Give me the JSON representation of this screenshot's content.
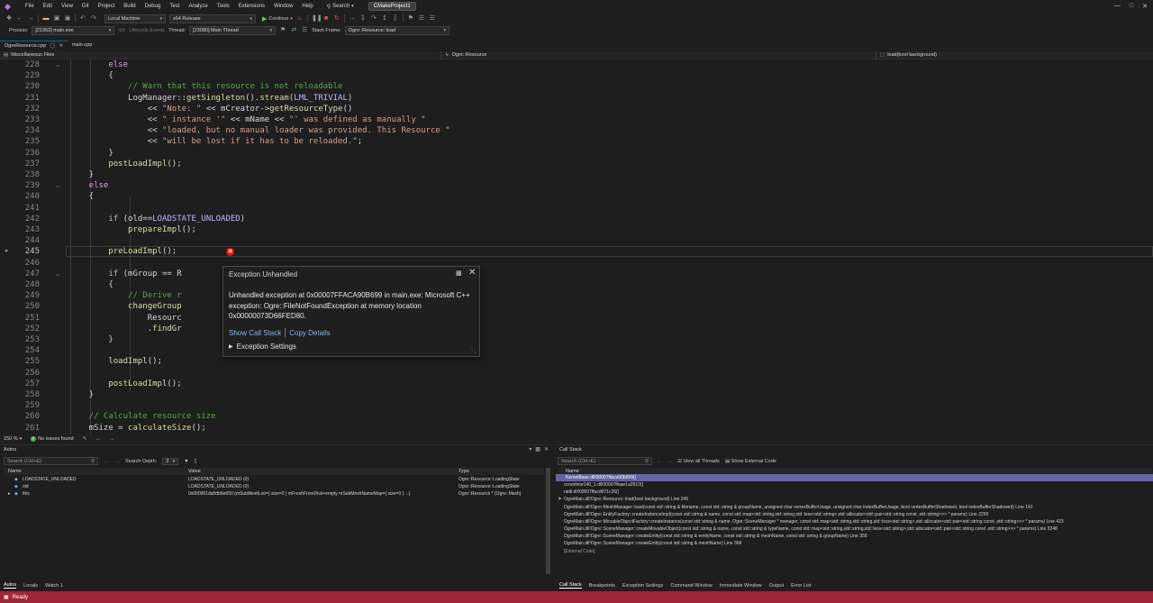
{
  "menu": {
    "items": [
      "File",
      "Edit",
      "View",
      "Git",
      "Project",
      "Build",
      "Debug",
      "Test",
      "Analyze",
      "Tools",
      "Extensions",
      "Window",
      "Help"
    ],
    "search_label": "Search",
    "project_name": "CMakeProject1"
  },
  "toolbar": {
    "target": "Local Machine",
    "config": "x64 Release",
    "continue_label": "Continue",
    "process_label": "Process:",
    "process_value": "[21952] main.exe",
    "lifecycle_label": "Lifecycle Events",
    "thread_label": "Thread:",
    "thread_value": "[23080] Main Thread",
    "stackframe_label": "Stack Frame:",
    "stackframe_value": "Ogre::Resource::load"
  },
  "tabs": [
    {
      "label": "OgreResource.cpp",
      "active": true
    },
    {
      "label": "main.cpp",
      "active": false
    }
  ],
  "navbar": {
    "scope": "Miscellaneous Files",
    "class": "Ogre::Resource",
    "member": "load(bool background)"
  },
  "editor": {
    "current_line": 245,
    "lines": [
      {
        "n": 228,
        "fold": true,
        "code": [
          [
            "kw",
            "        else"
          ]
        ]
      },
      {
        "n": 229,
        "code": [
          [
            "def",
            "        {"
          ]
        ]
      },
      {
        "n": 230,
        "code": [
          [
            "cm",
            "            // Warn that this resource is not reloadable"
          ]
        ]
      },
      {
        "n": 231,
        "code": [
          [
            "def",
            "            LogManager::"
          ],
          [
            "fn",
            "getSingleton"
          ],
          [
            "def",
            "()."
          ],
          [
            "fn",
            "stream"
          ],
          [
            "def",
            "("
          ],
          [
            "mac",
            "LML_TRIVIAL"
          ],
          [
            "def",
            ")"
          ]
        ]
      },
      {
        "n": 232,
        "code": [
          [
            "def",
            "                << "
          ],
          [
            "str",
            "\"Note: \""
          ],
          [
            "def",
            " << mCreator->"
          ],
          [
            "fn",
            "getResourceType"
          ],
          [
            "def",
            "()"
          ]
        ]
      },
      {
        "n": 233,
        "code": [
          [
            "def",
            "                << "
          ],
          [
            "str",
            "\" instance '\""
          ],
          [
            "def",
            " << mName << "
          ],
          [
            "str",
            "\"' was defined as manually \""
          ]
        ]
      },
      {
        "n": 234,
        "code": [
          [
            "def",
            "                << "
          ],
          [
            "str",
            "\"loaded, but no manual loader was provided. This Resource \""
          ]
        ]
      },
      {
        "n": 235,
        "code": [
          [
            "def",
            "                << "
          ],
          [
            "str",
            "\"will be lost if it has to be reloaded.\""
          ],
          [
            "def",
            ";"
          ]
        ]
      },
      {
        "n": 236,
        "code": [
          [
            "def",
            "        }"
          ]
        ]
      },
      {
        "n": 237,
        "code": [
          [
            "fn",
            "        postLoadImpl"
          ],
          [
            "def",
            "();"
          ]
        ]
      },
      {
        "n": 238,
        "code": [
          [
            "def",
            "    }"
          ]
        ]
      },
      {
        "n": 239,
        "fold": true,
        "code": [
          [
            "kw",
            "    else"
          ]
        ]
      },
      {
        "n": 240,
        "code": [
          [
            "def",
            "    {"
          ]
        ]
      },
      {
        "n": 241,
        "code": [
          [
            "def",
            ""
          ]
        ]
      },
      {
        "n": 242,
        "code": [
          [
            "kw",
            "        if"
          ],
          [
            "def",
            " (old=="
          ],
          [
            "mac",
            "LOADSTATE_UNLOADED"
          ],
          [
            "def",
            ")"
          ]
        ]
      },
      {
        "n": 243,
        "code": [
          [
            "fn",
            "            prepareImpl"
          ],
          [
            "def",
            "();"
          ]
        ]
      },
      {
        "n": 244,
        "code": [
          [
            "def",
            ""
          ]
        ]
      },
      {
        "n": 245,
        "code": [
          [
            "fn",
            "        preLoadImpl"
          ],
          [
            "def",
            "();"
          ]
        ]
      },
      {
        "n": 246,
        "code": [
          [
            "def",
            ""
          ]
        ]
      },
      {
        "n": 247,
        "fold": true,
        "code": [
          [
            "kw",
            "        if"
          ],
          [
            "def",
            " (mGroup == R"
          ]
        ]
      },
      {
        "n": 248,
        "code": [
          [
            "def",
            "        {"
          ]
        ]
      },
      {
        "n": 249,
        "code": [
          [
            "cm",
            "            // Derive r"
          ]
        ]
      },
      {
        "n": 250,
        "code": [
          [
            "fn",
            "            changeGroup"
          ]
        ]
      },
      {
        "n": 251,
        "code": [
          [
            "def",
            "                Resourc"
          ]
        ]
      },
      {
        "n": 252,
        "code": [
          [
            "def",
            "                ."
          ],
          [
            "fn",
            "findGr"
          ]
        ]
      },
      {
        "n": 253,
        "code": [
          [
            "def",
            "        }"
          ]
        ]
      },
      {
        "n": 254,
        "code": [
          [
            "def",
            ""
          ]
        ]
      },
      {
        "n": 255,
        "code": [
          [
            "fn",
            "        loadImpl"
          ],
          [
            "def",
            "();"
          ]
        ]
      },
      {
        "n": 256,
        "code": [
          [
            "def",
            ""
          ]
        ]
      },
      {
        "n": 257,
        "code": [
          [
            "fn",
            "        postLoadImpl"
          ],
          [
            "def",
            "();"
          ]
        ]
      },
      {
        "n": 258,
        "code": [
          [
            "def",
            "    }"
          ]
        ]
      },
      {
        "n": 259,
        "code": [
          [
            "def",
            ""
          ]
        ]
      },
      {
        "n": 260,
        "code": [
          [
            "cm",
            "    // Calculate resource size"
          ]
        ]
      },
      {
        "n": 261,
        "code": [
          [
            "def",
            "    mSize = "
          ],
          [
            "fn",
            "calculateSize"
          ],
          [
            "def",
            "();"
          ]
        ]
      }
    ]
  },
  "exception": {
    "title": "Exception Unhandled",
    "message": "Unhandled exception at 0x00007FFACA90B699 in main.exe: Microsoft C++ exception: Ogre::FileNotFoundException at memory location 0x00000073D66FED80.",
    "show_call_stack": "Show Call Stack",
    "copy_details": "Copy Details",
    "settings": "Exception Settings"
  },
  "editor_status": {
    "zoom": "150 %",
    "issues": "No issues found"
  },
  "autos": {
    "title": "Autos",
    "search_placeholder": "Search (Ctrl+E)",
    "depth_label": "Search Depth:",
    "depth_value": "3",
    "columns": [
      "Name",
      "Value",
      "Type"
    ],
    "rows": [
      {
        "name": "LOADSTATE_UNLOADED",
        "value": "LOADSTATE_UNLOADED (0)",
        "type": "Ogre::Resource::LoadingState"
      },
      {
        "name": "old",
        "value": "LOADSTATE_UNLOADED (0)",
        "type": "Ogre::Resource::LoadingState"
      },
      {
        "name": "this",
        "value": "0x000001da5db6e650 {mSubMeshList={ size=0 } mFreshFromDisk=empty mSubMeshNameMap={ size=0 } ...}",
        "type": "Ogre::Resource * {Ogre::Mesh}"
      }
    ]
  },
  "callstack": {
    "title": "Call Stack",
    "search_placeholder": "Search (Ctrl+E)",
    "view_threads": "View all Threads",
    "show_external": "Show External Code",
    "column": "Name",
    "rows": [
      {
        "text": "KernelBase.dll!00007ffaca90b699()",
        "style": "sel"
      },
      {
        "text": "vcruntime140_1.dll!00007ffaae1a2610()",
        "style": ""
      },
      {
        "text": "ntdll.dll!00007ffacd071c26()",
        "style": ""
      },
      {
        "text": "OgreMain.dll!Ogre::Resource::load(bool background) Line 245",
        "style": "cur"
      },
      {
        "text": "OgreMain.dll!Ogre::MeshManager::load(const std::string & filename, const std::string & groupName, unsigned char vertexBufferUsage, unsigned char indexBufferUsage, bool vertexBufferShadowed, bool indexBufferShadowed) Line 142",
        "style": ""
      },
      {
        "text": "OgreMain.dll!Ogre::EntityFactory::createInstanceImpl(const std::string & name, const std::map<std::string,std::string,std::less<std::string>,std::allocator<std::pair<std::string const ,std::string>>> * params) Line 2250",
        "style": ""
      },
      {
        "text": "OgreMain.dll!Ogre::MovableObjectFactory::createInstance(const std::string & name, Ogre::SceneManager * manager, const std::map<std::string,std::string,std::less<std::string>,std::allocator<std::pair<std::string const ,std::string>>> * params) Line 423",
        "style": ""
      },
      {
        "text": "OgreMain.dll!Ogre::SceneManager::createMovableObject(const std::string & name, const std::string & typeName, const std::map<std::string,std::string,std::less<std::string>,std::allocator<std::pair<std::string const ,std::string>>> * params) Line 3248",
        "style": ""
      },
      {
        "text": "OgreMain.dll!Ogre::SceneManager::createEntity(const std::string & entityName, const std::string & meshName, const std::string & groupName) Line 356",
        "style": ""
      },
      {
        "text": "OgreMain.dll!Ogre::SceneManager::createEntity(const std::string & meshName) Line 368",
        "style": ""
      },
      {
        "text": "[External Code]",
        "style": "dim"
      }
    ]
  },
  "bottom_tabs_left": [
    "Autos",
    "Locals",
    "Watch 1"
  ],
  "bottom_tabs_right": [
    "Call Stack",
    "Breakpoints",
    "Exception Settings",
    "Command Window",
    "Immediate Window",
    "Output",
    "Error List"
  ],
  "status": {
    "text": "Ready"
  },
  "colors": {
    "status_bar": "#a1263b",
    "selection": "#6264a7",
    "error": "#e51400"
  }
}
